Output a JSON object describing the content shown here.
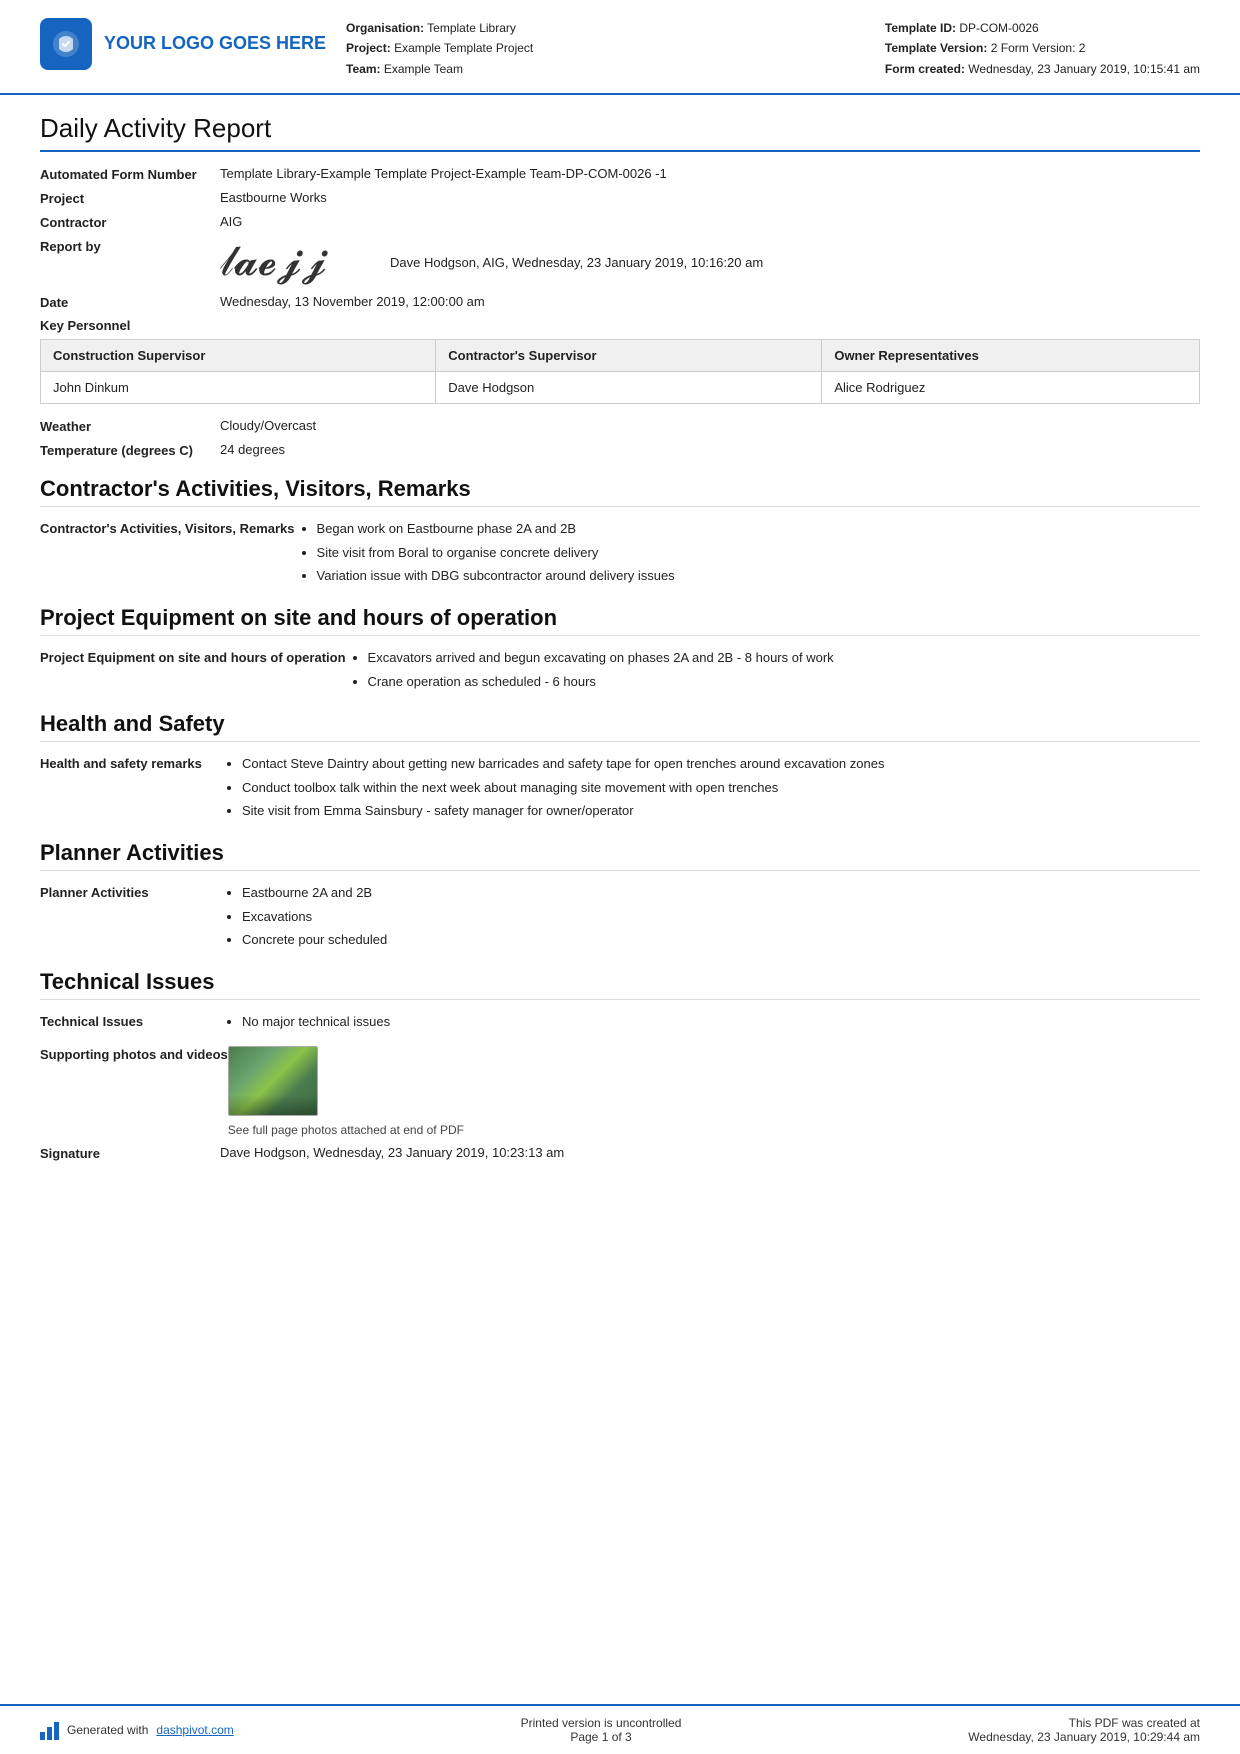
{
  "header": {
    "logo_text": "YOUR LOGO GOES HERE",
    "org_label": "Organisation:",
    "org_value": "Template Library",
    "project_label": "Project:",
    "project_value": "Example Template Project",
    "team_label": "Team:",
    "team_value": "Example Team",
    "template_id_label": "Template ID:",
    "template_id_value": "DP-COM-0026",
    "template_version_label": "Template Version:",
    "template_version_value": "2 Form Version: 2",
    "form_created_label": "Form created:",
    "form_created_value": "Wednesday, 23 January 2019, 10:15:41 am"
  },
  "doc_title": "Daily Activity Report",
  "fields": {
    "automated_form_number_label": "Automated Form Number",
    "automated_form_number_value": "Template Library-Example Template Project-Example Team-DP-COM-0026   -1",
    "project_label": "Project",
    "project_value": "Eastbourne Works",
    "contractor_label": "Contractor",
    "contractor_value": "AIG",
    "report_by_label": "Report by",
    "report_by_name": "Dave Hodgson, AIG, Wednesday, 23 January 2019, 10:16:20 am",
    "date_label": "Date",
    "date_value": "Wednesday, 13 November 2019, 12:00:00 am"
  },
  "key_personnel": {
    "label": "Key Personnel",
    "columns": [
      "Construction Supervisor",
      "Contractor's Supervisor",
      "Owner Representatives"
    ],
    "rows": [
      [
        "John Dinkum",
        "Dave Hodgson",
        "Alice Rodriguez"
      ]
    ]
  },
  "weather": {
    "label": "Weather",
    "value": "Cloudy/Overcast"
  },
  "temperature": {
    "label": "Temperature (degrees C)",
    "value": "24 degrees"
  },
  "sections": [
    {
      "heading": "Contractor's Activities, Visitors, Remarks",
      "field_label": "Contractor's Activities, Visitors, Remarks",
      "bullets": [
        "Began work on Eastbourne phase 2A and 2B",
        "Site visit from Boral to organise concrete delivery",
        "Variation issue with DBG subcontractor around delivery issues"
      ]
    },
    {
      "heading": "Project Equipment on site and hours of operation",
      "field_label": "Project Equipment on site and hours of operation",
      "bullets": [
        "Excavators arrived and begun excavating on phases 2A and 2B - 8 hours of work",
        "Crane operation as scheduled - 6 hours"
      ]
    },
    {
      "heading": "Health and Safety",
      "field_label": "Health and safety remarks",
      "bullets": [
        "Contact Steve Daintry about getting new barricades and safety tape for open trenches around excavation zones",
        "Conduct toolbox talk within the next week about managing site movement with open trenches",
        "Site visit from Emma Sainsbury - safety manager for owner/operator"
      ]
    },
    {
      "heading": "Planner Activities",
      "field_label": "Planner Activities",
      "bullets": [
        "Eastbourne 2A and 2B",
        "Excavations",
        "Concrete pour scheduled"
      ]
    }
  ],
  "technical_issues": {
    "heading": "Technical Issues",
    "field_label": "Technical Issues",
    "bullets": [
      "No major technical issues"
    ],
    "supporting_label": "Supporting photos and videos",
    "photo_caption": "See full page photos attached at end of PDF",
    "signature_label": "Signature",
    "signature_value": "Dave Hodgson, Wednesday, 23 January 2019, 10:23:13 am"
  },
  "footer": {
    "generated_text": "Generated with ",
    "link_text": "dashpivot.com",
    "center_line1": "Printed version is uncontrolled",
    "center_line2": "Page 1 of 3",
    "right_line1": "This PDF was created at",
    "right_line2": "Wednesday, 23 January 2019, 10:29:44 am"
  }
}
